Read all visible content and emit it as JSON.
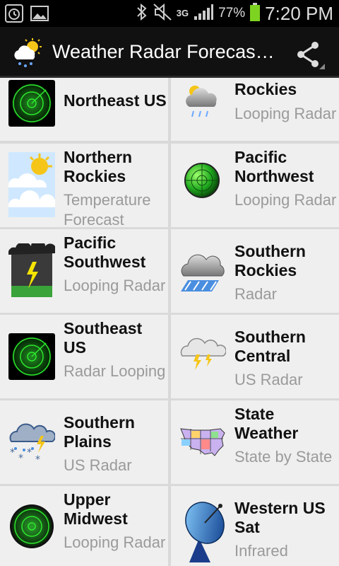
{
  "status_bar": {
    "network": "3G",
    "battery_percent": "77%",
    "time": "7:20 PM",
    "icons": [
      "alarm-icon",
      "image-icon",
      "bluetooth-icon",
      "mute-icon",
      "signal-icon",
      "battery-icon"
    ]
  },
  "action_bar": {
    "title": "Weather Radar Forecas…",
    "logo": "weather-logo-icon",
    "share": "share-icon"
  },
  "items": [
    {
      "title": "Northeast US",
      "sub": "",
      "icon": "radar-icon"
    },
    {
      "title": "Rockies",
      "sub": "Looping Radar",
      "icon": "storm-cloud-icon"
    },
    {
      "title": "Northern Rockies",
      "sub": "Temperature Forecast",
      "icon": "sun-clouds-icon"
    },
    {
      "title": "Pacific Northwest",
      "sub": "Looping Radar",
      "icon": "round-radar-icon"
    },
    {
      "title": "Pacific Southwest",
      "sub": "Looping Radar",
      "icon": "lightning-icon"
    },
    {
      "title": "Southern Rockies",
      "sub": "Radar",
      "icon": "rain-cloud-icon"
    },
    {
      "title": "Southeast US",
      "sub": "Radar Looping",
      "icon": "radar-icon"
    },
    {
      "title": "Southern Central",
      "sub": "US Radar",
      "icon": "thunder-cloud-icon"
    },
    {
      "title": "Southern Plains",
      "sub": "US Radar",
      "icon": "snow-thunder-icon"
    },
    {
      "title": "State Weather",
      "sub": "State by State",
      "icon": "us-map-icon"
    },
    {
      "title": "Upper Midwest",
      "sub": "Looping Radar",
      "icon": "round-radar-icon"
    },
    {
      "title": "Western US Sat",
      "sub": "Infrared",
      "icon": "satellite-dish-icon"
    }
  ],
  "colors": {
    "radar_green": "#2ee82e",
    "action_bar": "#111111",
    "cell_bg": "#efefef",
    "subtitle": "#9a9a9a",
    "battery": "#7ed321"
  }
}
